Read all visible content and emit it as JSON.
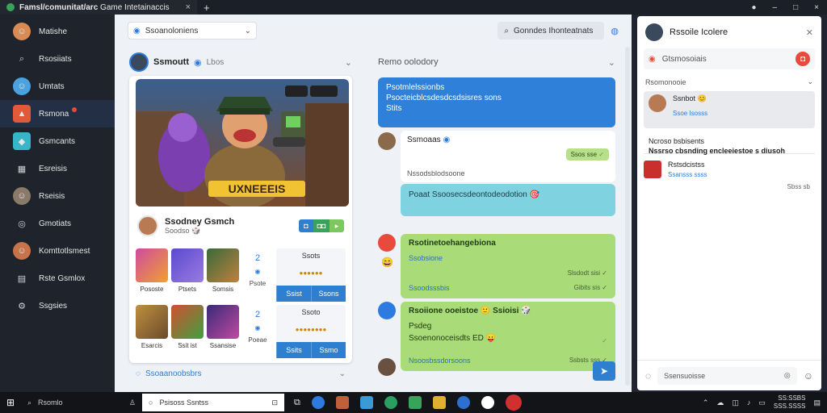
{
  "window": {
    "tab_title_bold": "Famsl/comunitat/arc",
    "tab_title_rest": "Game Intetainaccis",
    "tab_close": "×",
    "new_tab": "+",
    "controls": [
      "–",
      "□",
      "×"
    ]
  },
  "sidebar": {
    "items": [
      {
        "label": "Matishe",
        "icon": "avatar-icon"
      },
      {
        "label": "Rsosiiats",
        "icon": "search-icon"
      },
      {
        "label": "Umtats",
        "icon": "avatar-icon"
      },
      {
        "label": "Rsmona",
        "icon": "game-icon",
        "active": true,
        "badge": true
      },
      {
        "label": "Gsmcants",
        "icon": "game-icon"
      },
      {
        "label": "Esreisis",
        "icon": "grid-icon"
      },
      {
        "label": "Rseisis",
        "icon": "avatar-icon"
      },
      {
        "label": "Gmotiats",
        "icon": "controller-icon"
      },
      {
        "label": "Komttotlsmest",
        "icon": "avatar-icon"
      },
      {
        "label": "Rste Gsmlox",
        "icon": "calendar-icon"
      },
      {
        "label": "Ssgsies",
        "icon": "gear-icon"
      }
    ]
  },
  "topbar": {
    "select_label": "Ssoanoloniens",
    "search_label": "Gonndes Ihonteatnats"
  },
  "feed": {
    "header_name": "Ssmoutt",
    "header_sub": "Lbos",
    "streamer_name": "Ssodney Gsmch",
    "streamer_sub": "Soodso",
    "streamer_emoji": "🎲",
    "hero_logo": "UXNEEEIS",
    "pill_a": "◘",
    "pill_b": "◘◘",
    "rows": [
      {
        "thumbs": [
          "Pososte",
          "Ptsets",
          "Somsis"
        ],
        "count": "2",
        "mid_label": "Psote",
        "col_title": "Ssots",
        "col_mini": "●●●●●●",
        "btn_a": "Ssist",
        "btn_b": "Ssons"
      },
      {
        "thumbs": [
          "Esarcis",
          "Ssit ist",
          "Ssansise"
        ],
        "count": "2",
        "mid_label": "Poeae",
        "col_title": "Ssoto",
        "col_mini": "●●●●●●●●",
        "btn_a": "Ssits",
        "btn_b": "Ssmo"
      }
    ],
    "more_label": "Ssoaanoobsbrs"
  },
  "chat": {
    "header": "Remo oolodory",
    "blue_lines": [
      "Psotmlelssionbs",
      "Psocteicblcsdesdcsdsisres sons",
      "Stits"
    ],
    "white_name": "Ssmoaas",
    "white_badge": "Ssos sse",
    "white_sub": "Nssodsblodsoone",
    "cyan_text": "Poaat Ssoosecsdeontodeodotion 🎯",
    "green1_title": "Rsotinetoehangebiona",
    "green1_sub": "Ssobsione",
    "green1_meta1": "Slsdodt sisi ✓",
    "green1_meta2": "Gibits sis ✓",
    "green1_sub2": "Ssoodsssbis",
    "green2_title": "Rsoiione ooeistoe 🙂 Ssioisi 🎲",
    "green2_line2": "Psdeg",
    "green2_line3": "Ssoenonoceisdts ED 😛",
    "green2_sub": "Nsoosbssdorsoons",
    "green2_meta": "Ssbsts sss ✓",
    "send_icon": "➤"
  },
  "panel": {
    "title": "Rssoile Icolere",
    "input_placeholder": "Gtsmosoiais",
    "section_label": "Rsomonooie",
    "msg_name": "Ssnbot",
    "msg_sub": "Ssoe Isosss",
    "note_title": "Ncroso bsbisents",
    "note_body": "Nssrso cbsnding encleeiestoe s diusoh",
    "alert_title": "Rstsdcistss",
    "alert_sub": "Ssansss ssss",
    "time": "Sbss sb",
    "footer_placeholder": "Ssensuoisse"
  },
  "taskbar": {
    "search": "Rsomlo",
    "search2": "Psisoss Ssntss",
    "clock_time": "SS:SSBS",
    "clock_date": "SSS.SSSS"
  },
  "colors": {
    "accent_blue": "#2f80d8",
    "chat_green": "#a9dc78",
    "chat_cyan": "#7fd2e0",
    "alert_red": "#c9302c"
  }
}
